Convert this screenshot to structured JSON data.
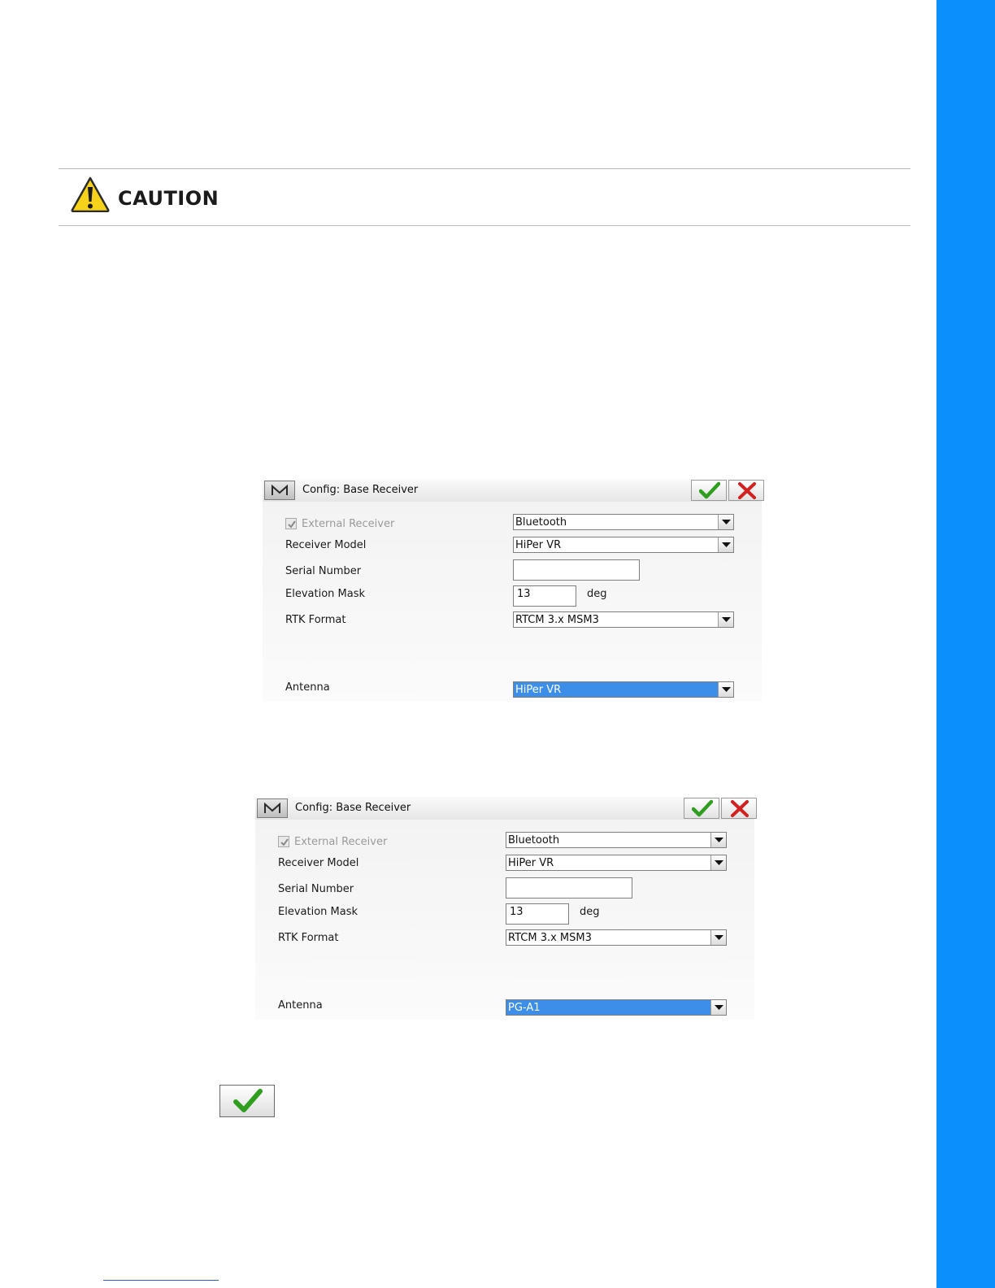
{
  "caution": {
    "label": "CAUTION",
    "icon": "warning-icon"
  },
  "dialogs": [
    {
      "menu_label": "M",
      "title": "Config: Base Receiver",
      "external_receiver": {
        "label": "External Receiver",
        "checked": true,
        "disabled": true
      },
      "connection": "Bluetooth",
      "receiver_model": {
        "label": "Receiver Model",
        "value": "HiPer VR"
      },
      "serial_number": {
        "label": "Serial Number",
        "value": ""
      },
      "elevation_mask": {
        "label": "Elevation Mask",
        "value": "13",
        "unit": "deg"
      },
      "rtk_format": {
        "label": "RTK Format",
        "value": "RTCM 3.x MSM3"
      },
      "antenna": {
        "label": "Antenna",
        "value": "HiPer VR"
      }
    },
    {
      "menu_label": "M",
      "title": "Config: Base Receiver",
      "external_receiver": {
        "label": "External Receiver",
        "checked": true,
        "disabled": true
      },
      "connection": "Bluetooth",
      "receiver_model": {
        "label": "Receiver Model",
        "value": "HiPer VR"
      },
      "serial_number": {
        "label": "Serial Number",
        "value": ""
      },
      "elevation_mask": {
        "label": "Elevation Mask",
        "value": "13",
        "unit": "deg"
      },
      "rtk_format": {
        "label": "RTK Format",
        "value": "RTCM 3.x MSM3"
      },
      "antenna": {
        "label": "Antenna",
        "value": "PG-A1"
      }
    }
  ],
  "colors": {
    "accent_bar": "#0b8ffd",
    "selection": "#3d8ee8",
    "ok_green": "#2f9e1f",
    "cancel_red": "#d42020"
  }
}
